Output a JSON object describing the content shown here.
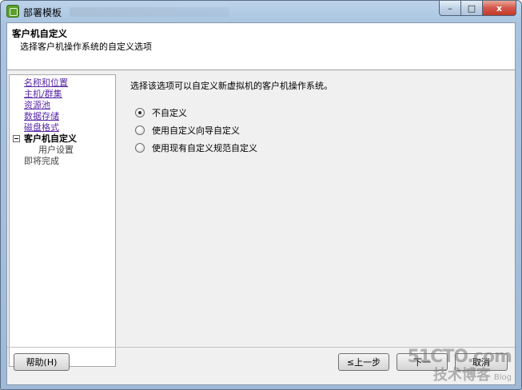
{
  "window": {
    "title": "部署模板",
    "caption": {
      "minimize": "–",
      "maximize": "□",
      "close": "x"
    }
  },
  "header": {
    "title": "客户机自定义",
    "subtitle": "选择客户机操作系统的自定义选项"
  },
  "nav": {
    "items": [
      {
        "label": "名称和位置",
        "state": "link"
      },
      {
        "label": "主机/群集",
        "state": "link"
      },
      {
        "label": "资源池",
        "state": "link"
      },
      {
        "label": "数据存储",
        "state": "link"
      },
      {
        "label": "磁盘格式",
        "state": "link"
      },
      {
        "label": "客户机自定义",
        "state": "current"
      },
      {
        "label": "用户设置",
        "state": "sub"
      },
      {
        "label": "即将完成",
        "state": "pending"
      }
    ]
  },
  "content": {
    "description": "选择该选项可以自定义新虚拟机的客户机操作系统。",
    "options": [
      {
        "label": "不自定义",
        "checked": true
      },
      {
        "label": "使用自定义向导自定义",
        "checked": false
      },
      {
        "label": "使用现有自定义规范自定义",
        "checked": false
      }
    ]
  },
  "footer": {
    "help": "帮助(H)",
    "back": "≤上一步",
    "next": "下一",
    "finish": "取消"
  },
  "watermark": {
    "site": "51CTO.com",
    "tagline": "技术博客",
    "blog": "Blog"
  }
}
